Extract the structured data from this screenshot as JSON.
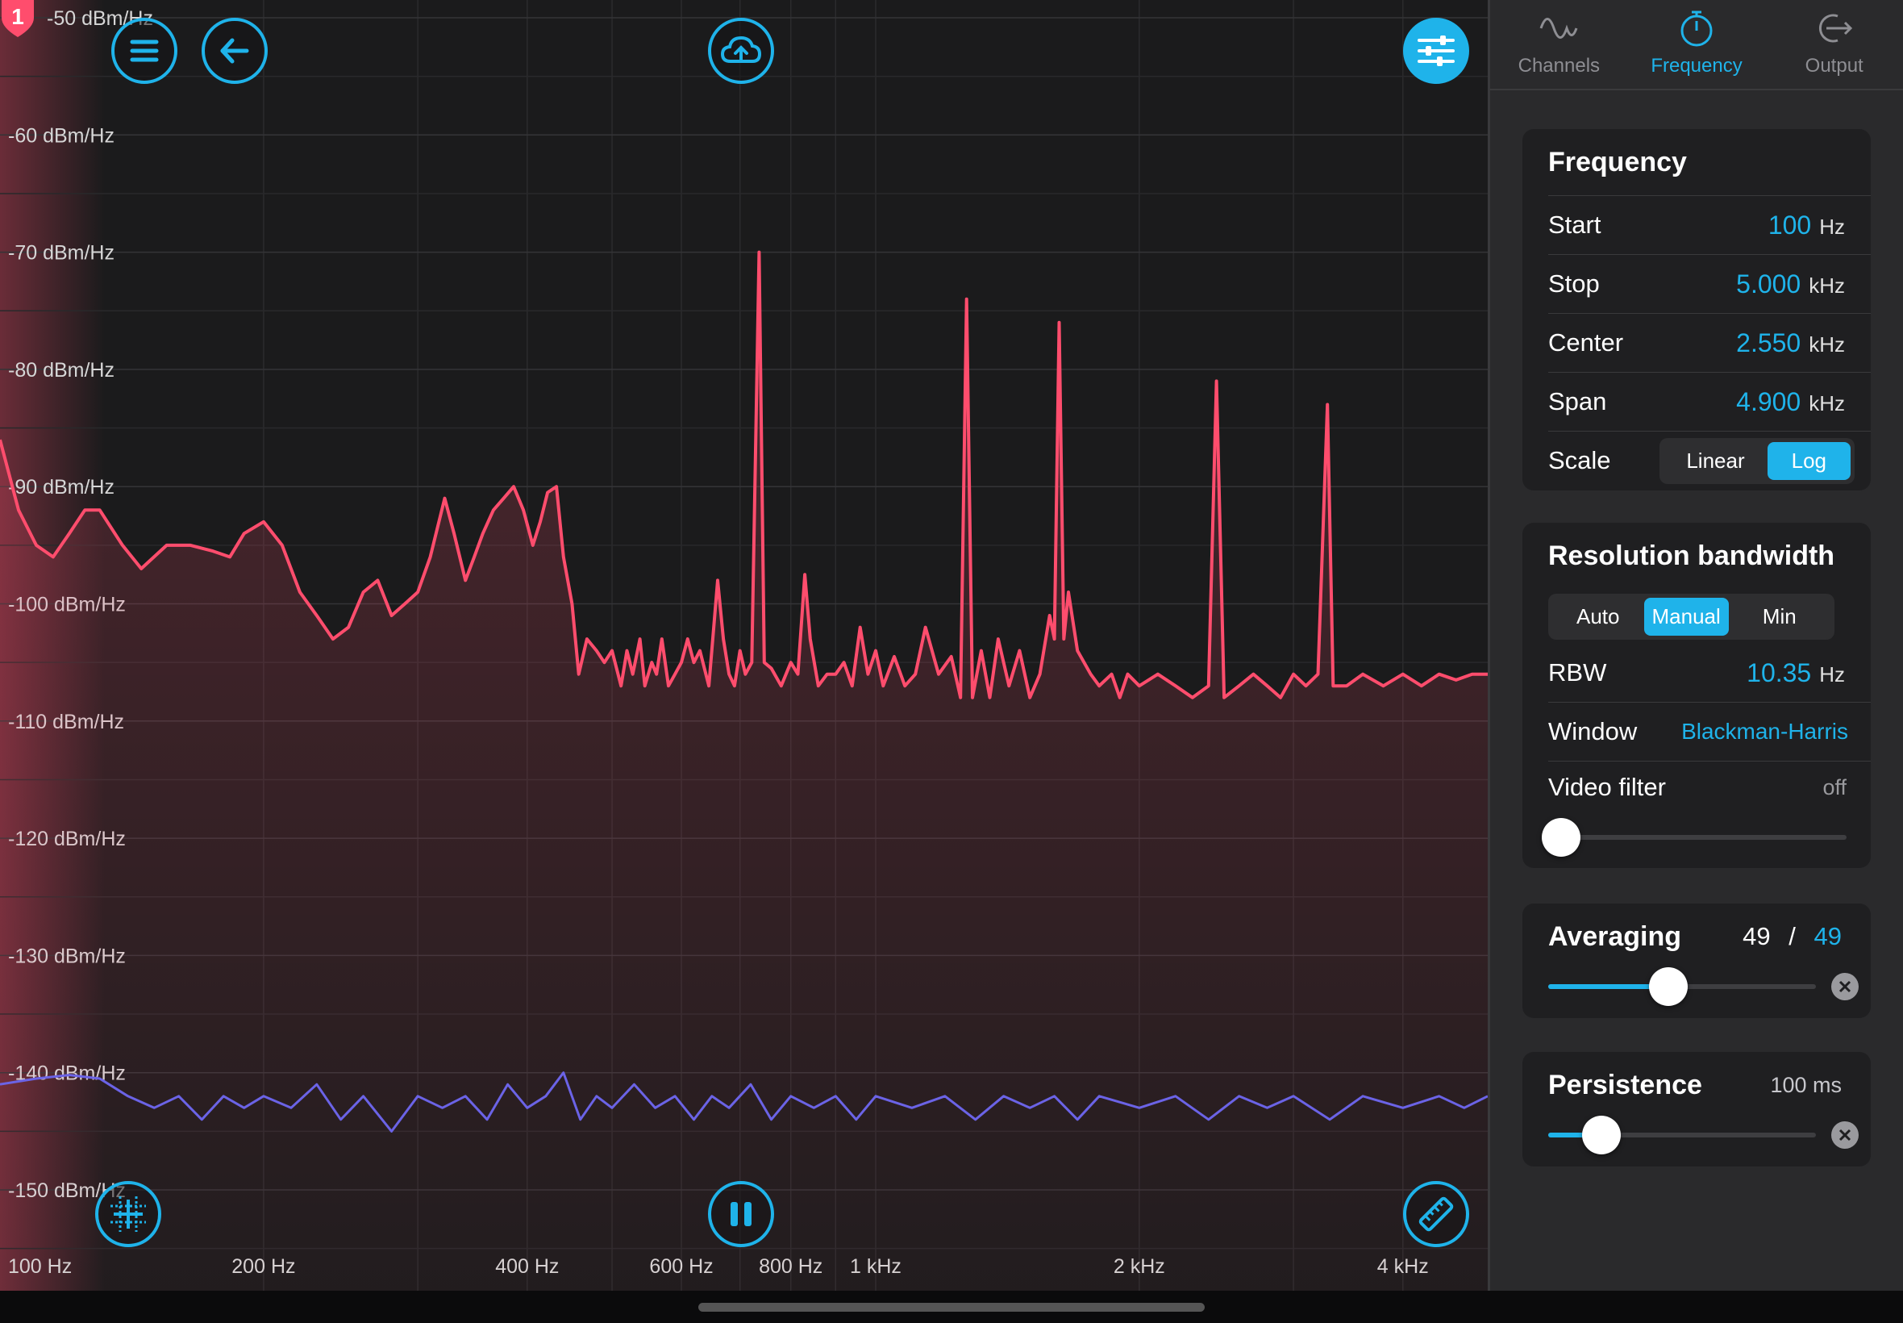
{
  "plot": {
    "marker_label": "1",
    "y_labels": [
      "-50 dBm/Hz",
      "-60 dBm/Hz",
      "-70 dBm/Hz",
      "-80 dBm/Hz",
      "-90 dBm/Hz",
      "-100 dBm/Hz",
      "-110 dBm/Hz",
      "-120 dBm/Hz",
      "-130 dBm/Hz",
      "-140 dBm/Hz",
      "-150 dBm/Hz"
    ],
    "x_labels": [
      {
        "text": "100 Hz",
        "hz": 100
      },
      {
        "text": "200 Hz",
        "hz": 200
      },
      {
        "text": "400 Hz",
        "hz": 400
      },
      {
        "text": "600 Hz",
        "hz": 600
      },
      {
        "text": "800 Hz",
        "hz": 800
      },
      {
        "text": "1 kHz",
        "hz": 1000
      },
      {
        "text": "2 kHz",
        "hz": 2000
      },
      {
        "text": "4 kHz",
        "hz": 4000
      }
    ]
  },
  "chart_data": {
    "type": "line",
    "x_scale": "log",
    "xlim": [
      100,
      5000
    ],
    "ylim": [
      -150,
      -50
    ],
    "grid": true,
    "series": [
      {
        "color": "#ff4d6d",
        "points": [
          [
            100,
            -86
          ],
          [
            105,
            -92
          ],
          [
            110,
            -95
          ],
          [
            115,
            -96
          ],
          [
            120,
            -94
          ],
          [
            125,
            -92
          ],
          [
            130,
            -92
          ],
          [
            138,
            -95
          ],
          [
            145,
            -97
          ],
          [
            155,
            -95
          ],
          [
            165,
            -95
          ],
          [
            175,
            -95.5
          ],
          [
            183,
            -96
          ],
          [
            190,
            -94
          ],
          [
            200,
            -93
          ],
          [
            210,
            -95
          ],
          [
            220,
            -99
          ],
          [
            230,
            -101
          ],
          [
            240,
            -103
          ],
          [
            250,
            -102
          ],
          [
            260,
            -99
          ],
          [
            270,
            -98
          ],
          [
            280,
            -101
          ],
          [
            290,
            -100
          ],
          [
            300,
            -99
          ],
          [
            310,
            -96
          ],
          [
            322,
            -91
          ],
          [
            330,
            -94
          ],
          [
            340,
            -98
          ],
          [
            348,
            -96
          ],
          [
            356,
            -94
          ],
          [
            366,
            -92
          ],
          [
            376,
            -91
          ],
          [
            386,
            -90
          ],
          [
            396,
            -92
          ],
          [
            406,
            -95
          ],
          [
            414,
            -93
          ],
          [
            422,
            -90.5
          ],
          [
            432,
            -90
          ],
          [
            440,
            -96
          ],
          [
            450,
            -100
          ],
          [
            458,
            -106
          ],
          [
            468,
            -103
          ],
          [
            480,
            -104
          ],
          [
            490,
            -105
          ],
          [
            500,
            -104
          ],
          [
            512,
            -107
          ],
          [
            520,
            -104
          ],
          [
            528,
            -106
          ],
          [
            538,
            -103
          ],
          [
            545,
            -107
          ],
          [
            555,
            -105
          ],
          [
            562,
            -106
          ],
          [
            570,
            -103
          ],
          [
            580,
            -107
          ],
          [
            590,
            -106
          ],
          [
            600,
            -105
          ],
          [
            610,
            -103
          ],
          [
            620,
            -105
          ],
          [
            630,
            -104
          ],
          [
            645,
            -107
          ],
          [
            660,
            -98
          ],
          [
            670,
            -103
          ],
          [
            680,
            -106
          ],
          [
            690,
            -107
          ],
          [
            700,
            -104
          ],
          [
            710,
            -106
          ],
          [
            722,
            -105
          ],
          [
            736,
            -70
          ],
          [
            746,
            -105
          ],
          [
            760,
            -105.5
          ],
          [
            780,
            -107
          ],
          [
            800,
            -105
          ],
          [
            815,
            -106
          ],
          [
            830,
            -97.5
          ],
          [
            842,
            -103
          ],
          [
            860,
            -107
          ],
          [
            880,
            -106
          ],
          [
            900,
            -106
          ],
          [
            920,
            -105
          ],
          [
            940,
            -107
          ],
          [
            960,
            -102
          ],
          [
            980,
            -106
          ],
          [
            1000,
            -104
          ],
          [
            1020,
            -107
          ],
          [
            1050,
            -104.5
          ],
          [
            1080,
            -107
          ],
          [
            1110,
            -106
          ],
          [
            1140,
            -102
          ],
          [
            1180,
            -106
          ],
          [
            1220,
            -104.5
          ],
          [
            1250,
            -108
          ],
          [
            1270,
            -74
          ],
          [
            1290,
            -108
          ],
          [
            1320,
            -104
          ],
          [
            1350,
            -108
          ],
          [
            1380,
            -103
          ],
          [
            1420,
            -107
          ],
          [
            1460,
            -104
          ],
          [
            1500,
            -108
          ],
          [
            1540,
            -106
          ],
          [
            1580,
            -101
          ],
          [
            1600,
            -103
          ],
          [
            1620,
            -76
          ],
          [
            1640,
            -103
          ],
          [
            1660,
            -99
          ],
          [
            1700,
            -104
          ],
          [
            1760,
            -106
          ],
          [
            1800,
            -107
          ],
          [
            1860,
            -106
          ],
          [
            1900,
            -108
          ],
          [
            1940,
            -106
          ],
          [
            2000,
            -107
          ],
          [
            2100,
            -106
          ],
          [
            2200,
            -107
          ],
          [
            2300,
            -108
          ],
          [
            2400,
            -107
          ],
          [
            2450,
            -81
          ],
          [
            2500,
            -108
          ],
          [
            2600,
            -107
          ],
          [
            2700,
            -106
          ],
          [
            2800,
            -107
          ],
          [
            2900,
            -108
          ],
          [
            3000,
            -106
          ],
          [
            3100,
            -107
          ],
          [
            3200,
            -106
          ],
          [
            3280,
            -83
          ],
          [
            3330,
            -107
          ],
          [
            3450,
            -107
          ],
          [
            3600,
            -106
          ],
          [
            3800,
            -107
          ],
          [
            4000,
            -106
          ],
          [
            4200,
            -107
          ],
          [
            4400,
            -106
          ],
          [
            4600,
            -106.5
          ],
          [
            4800,
            -106
          ],
          [
            5000,
            -106
          ]
        ]
      },
      {
        "color": "#6b63e6",
        "points": [
          [
            100,
            -141
          ],
          [
            110,
            -140.5
          ],
          [
            120,
            -140.2
          ],
          [
            130,
            -140.5
          ],
          [
            140,
            -142
          ],
          [
            150,
            -143
          ],
          [
            160,
            -142
          ],
          [
            170,
            -144
          ],
          [
            180,
            -142
          ],
          [
            190,
            -143
          ],
          [
            200,
            -142
          ],
          [
            215,
            -143
          ],
          [
            230,
            -141
          ],
          [
            245,
            -144
          ],
          [
            260,
            -142
          ],
          [
            280,
            -145
          ],
          [
            300,
            -142
          ],
          [
            320,
            -143
          ],
          [
            340,
            -142
          ],
          [
            360,
            -144
          ],
          [
            380,
            -141
          ],
          [
            400,
            -143
          ],
          [
            420,
            -142
          ],
          [
            440,
            -140
          ],
          [
            460,
            -144
          ],
          [
            480,
            -142
          ],
          [
            500,
            -143
          ],
          [
            530,
            -141
          ],
          [
            560,
            -143
          ],
          [
            590,
            -142
          ],
          [
            620,
            -144
          ],
          [
            650,
            -142
          ],
          [
            680,
            -143
          ],
          [
            720,
            -141
          ],
          [
            760,
            -144
          ],
          [
            800,
            -142
          ],
          [
            850,
            -143
          ],
          [
            900,
            -142
          ],
          [
            950,
            -144
          ],
          [
            1000,
            -142
          ],
          [
            1100,
            -143
          ],
          [
            1200,
            -142
          ],
          [
            1300,
            -144
          ],
          [
            1400,
            -142
          ],
          [
            1500,
            -143
          ],
          [
            1600,
            -142
          ],
          [
            1700,
            -144
          ],
          [
            1800,
            -142
          ],
          [
            2000,
            -143
          ],
          [
            2200,
            -142
          ],
          [
            2400,
            -144
          ],
          [
            2600,
            -142
          ],
          [
            2800,
            -143
          ],
          [
            3000,
            -142
          ],
          [
            3300,
            -144
          ],
          [
            3600,
            -142
          ],
          [
            4000,
            -143
          ],
          [
            4400,
            -142
          ],
          [
            4700,
            -143
          ],
          [
            5000,
            -142
          ]
        ]
      }
    ]
  },
  "toolbar": {
    "menu_icon": "hamburger-menu-icon",
    "back_icon": "arrow-left-icon",
    "upload_icon": "cloud-upload-icon",
    "settings_icon": "sliders-icon",
    "grid_icon": "crosshair-grid-icon",
    "pause_icon": "pause-icon",
    "ruler_icon": "ruler-icon"
  },
  "tabs": [
    {
      "label": "Channels",
      "icon": "sine-wave-icon"
    },
    {
      "label": "Frequency",
      "icon": "stopwatch-icon"
    },
    {
      "label": "Output",
      "icon": "output-arrow-icon"
    }
  ],
  "frequency": {
    "title": "Frequency",
    "start": {
      "label": "Start",
      "value": "100",
      "unit": "Hz"
    },
    "stop": {
      "label": "Stop",
      "value": "5.000",
      "unit": "kHz"
    },
    "center": {
      "label": "Center",
      "value": "2.550",
      "unit": "kHz"
    },
    "span": {
      "label": "Span",
      "value": "4.900",
      "unit": "kHz"
    },
    "scale": {
      "label": "Scale",
      "options": [
        "Linear",
        "Log"
      ],
      "selected": "Log"
    }
  },
  "rbw": {
    "title": "Resolution bandwidth",
    "modes": [
      "Auto",
      "Manual",
      "Min"
    ],
    "selected": "Manual",
    "rbw": {
      "label": "RBW",
      "value": "10.35",
      "unit": "Hz"
    },
    "window": {
      "label": "Window",
      "value": "Blackman-Harris"
    },
    "video_filter": {
      "label": "Video filter",
      "value": "off",
      "level": 0
    }
  },
  "averaging": {
    "title": "Averaging",
    "current": "49",
    "separator": "/",
    "total": "49",
    "level": 0.45
  },
  "persistence": {
    "title": "Persistence",
    "value": "100 ms",
    "level": 0.2
  },
  "colors": {
    "accent": "#1fb3ea",
    "trace1": "#ff4d6d",
    "trace2": "#6b63e6"
  }
}
